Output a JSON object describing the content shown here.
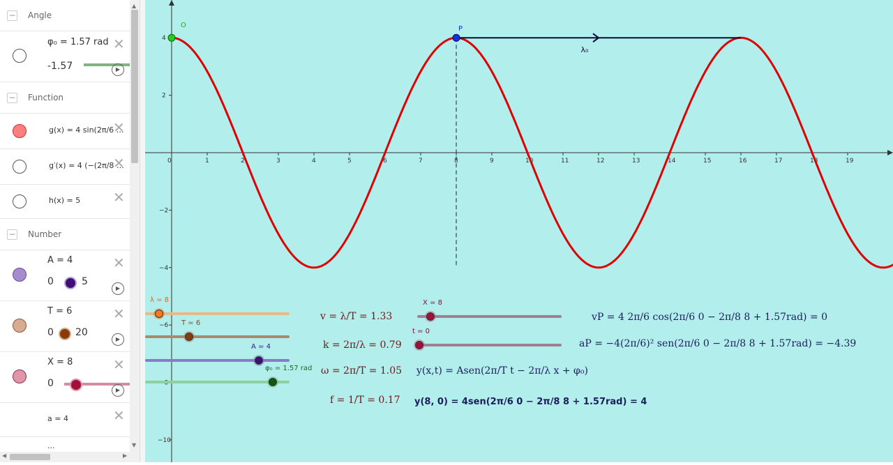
{
  "algebra": {
    "groups": {
      "angle": "Angle",
      "function": "Function",
      "number": "Number"
    },
    "phi_row": {
      "label": "φ₀ = 1.57 rad",
      "min": "-1.57"
    },
    "g_row": "g(x) = 4 sin(2π/6 …",
    "gp_row": "g′(x) = 4 (−(2π/8 …",
    "h_row": "h(x) = 5",
    "A_row": {
      "label": "A = 4",
      "min": "0",
      "max": "5"
    },
    "T_row": {
      "label": "T = 6",
      "min": "0",
      "max": "20"
    },
    "X_row": {
      "label": "X = 8",
      "min": "0"
    },
    "a_row": "a = 4",
    "cut_row": "...",
    "colors": {
      "phi": "#82b482",
      "g": "#ff7f7f",
      "A": "#a58ccc",
      "T": "#c99a7e",
      "X": "#d77f96"
    }
  },
  "graph": {
    "point_O": "O",
    "point_P": "P",
    "vector_label": "λ₀",
    "x_ticks": [
      "0",
      "1",
      "2",
      "3",
      "4",
      "5",
      "6",
      "7",
      "8",
      "9",
      "10",
      "11",
      "12",
      "13",
      "14",
      "15",
      "16",
      "17",
      "18",
      "19"
    ],
    "y_ticks": [
      "4",
      "2",
      "−2",
      "−4",
      "−6",
      "−8",
      "−10"
    ],
    "curve_color": "#e00000"
  },
  "sliders": {
    "lambda": "λ = 8",
    "T": "T = 6",
    "A": "A = 4",
    "phi": "φ₀ = 1.57 rad",
    "X": "X = 8",
    "t": "t = 0"
  },
  "formulas": {
    "v": "v = λ/T = 1.33",
    "k": "k = 2π/λ = 0.79",
    "w": "ω = 2π/T = 1.05",
    "f": "f = 1/T = 0.17",
    "wave": "y(x,t) = Asen(2π/T t − 2π/λ x + φ₀)",
    "y80": "y(8, 0) = 4sen(2π/6 0 − 2π/8 8 + 1.57rad) = 4",
    "vP": "vP = 4 2π/6 cos(2π/6 0 − 2π/8 8 + 1.57rad) = 0",
    "aP": "aP = −4(2π/6)² sen(2π/6 0 − 2π/8 8 + 1.57rad) = −4.39"
  }
}
